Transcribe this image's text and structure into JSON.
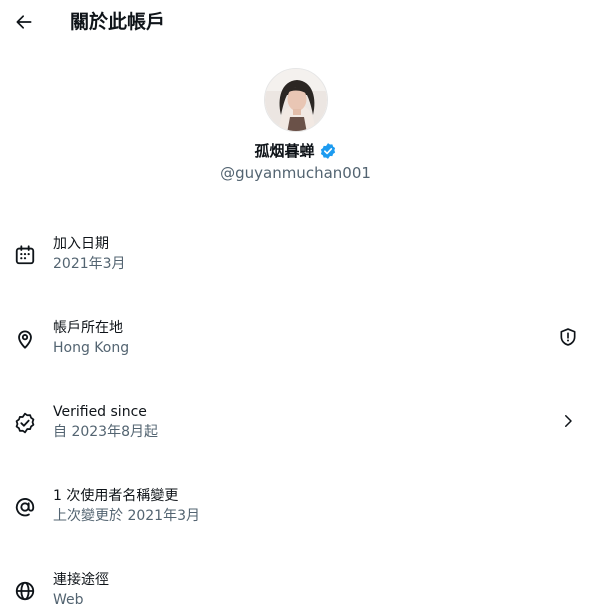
{
  "header": {
    "title": "關於此帳戶"
  },
  "profile": {
    "name": "孤烟暮蝉",
    "handle": "@guyanmuchan001"
  },
  "rows": [
    {
      "label": "加入日期",
      "value": "2021年3月",
      "icon": "calendar-icon"
    },
    {
      "label": "帳戶所在地",
      "value": "Hong Kong",
      "icon": "location-pin-icon",
      "trail_icon": "shield-alert-icon"
    },
    {
      "label": "Verified since",
      "value": "自 2023年8月起",
      "icon": "verified-badge-icon",
      "trail_icon": "chevron-right-icon"
    },
    {
      "label": "1 次使用者名稱變更",
      "value": "上次變更於 2021年3月",
      "icon": "at-sign-icon"
    },
    {
      "label": "連接途徑",
      "value": "Web",
      "icon": "globe-icon"
    }
  ],
  "colors": {
    "verified": "#1d9bf0",
    "secondary_text": "#536471"
  }
}
